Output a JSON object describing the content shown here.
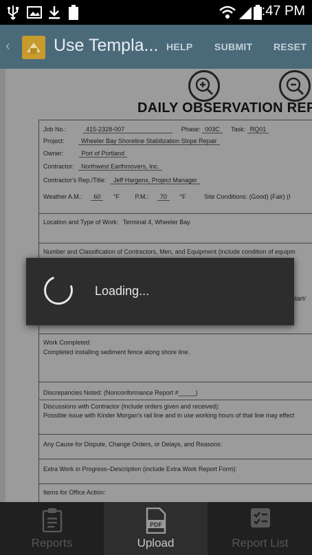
{
  "status_bar": {
    "time": "2:47 PM",
    "battery": "100"
  },
  "action_bar": {
    "title": "Use Templa...",
    "buttons": [
      "HELP",
      "SUBMIT",
      "RESET"
    ]
  },
  "document": {
    "title": "DAILY OBSERVATION REPO",
    "fields": {
      "job_no_label": "Job No.:",
      "job_no": "415-2328-007",
      "phase_label": "Phase:",
      "phase": "003C",
      "task_label": "Task:",
      "task": "RQ01",
      "project_label": "Project:",
      "project": "Wheeler Bay Shoreline Stabilization Slope Repair",
      "owner_label": "Owner:",
      "owner": "Port of Portland",
      "contractor_label": "Contractor:",
      "contractor": "Northwest Earthmovers, Inc.",
      "rep_label": "Contractor's Rep./Title:",
      "rep": "Jeff Hargens, Project Manager",
      "weather_am_label": "Weather A.M.:",
      "weather_am": "60",
      "unit_f": "°F",
      "pm_label": "P.M.:",
      "weather_pm": "70",
      "site_conditions": "Site Conditions: (Good) (Fair) (I",
      "location_label": "Location and Type of Work:",
      "location": "Terminal 4, Wheeler Bay",
      "number_label": "Number and Classification of Contractors, Men, and Equipment (include condition of equipm",
      "start_fragment": "start/",
      "work_label": "Work Completed:",
      "work": "Completed installing sediment fence along shore line.",
      "discrepancies": "Discrepancies Noted: (Nonconformance Report #_____)",
      "discussions_label": "Discussions with Contractor (include orders given and received):",
      "discussions": "Possible issue with Kinder Morgan's rail line and in use working hours of that line may effect",
      "dispute": "Any Cause for Dispute, Change Orders, or Delays, and Reasons:",
      "extra": "Extra Work in Progress–Description (include Extra Work Report Form):",
      "office": "Items for Office Action:"
    }
  },
  "dialog": {
    "text": "Loading..."
  },
  "bottom_nav": {
    "tabs": [
      {
        "label": "Reports",
        "icon": "clipboard-icon"
      },
      {
        "label": "Upload",
        "icon": "pdf-icon"
      },
      {
        "label": "Report List",
        "icon": "checklist-icon"
      }
    ]
  }
}
